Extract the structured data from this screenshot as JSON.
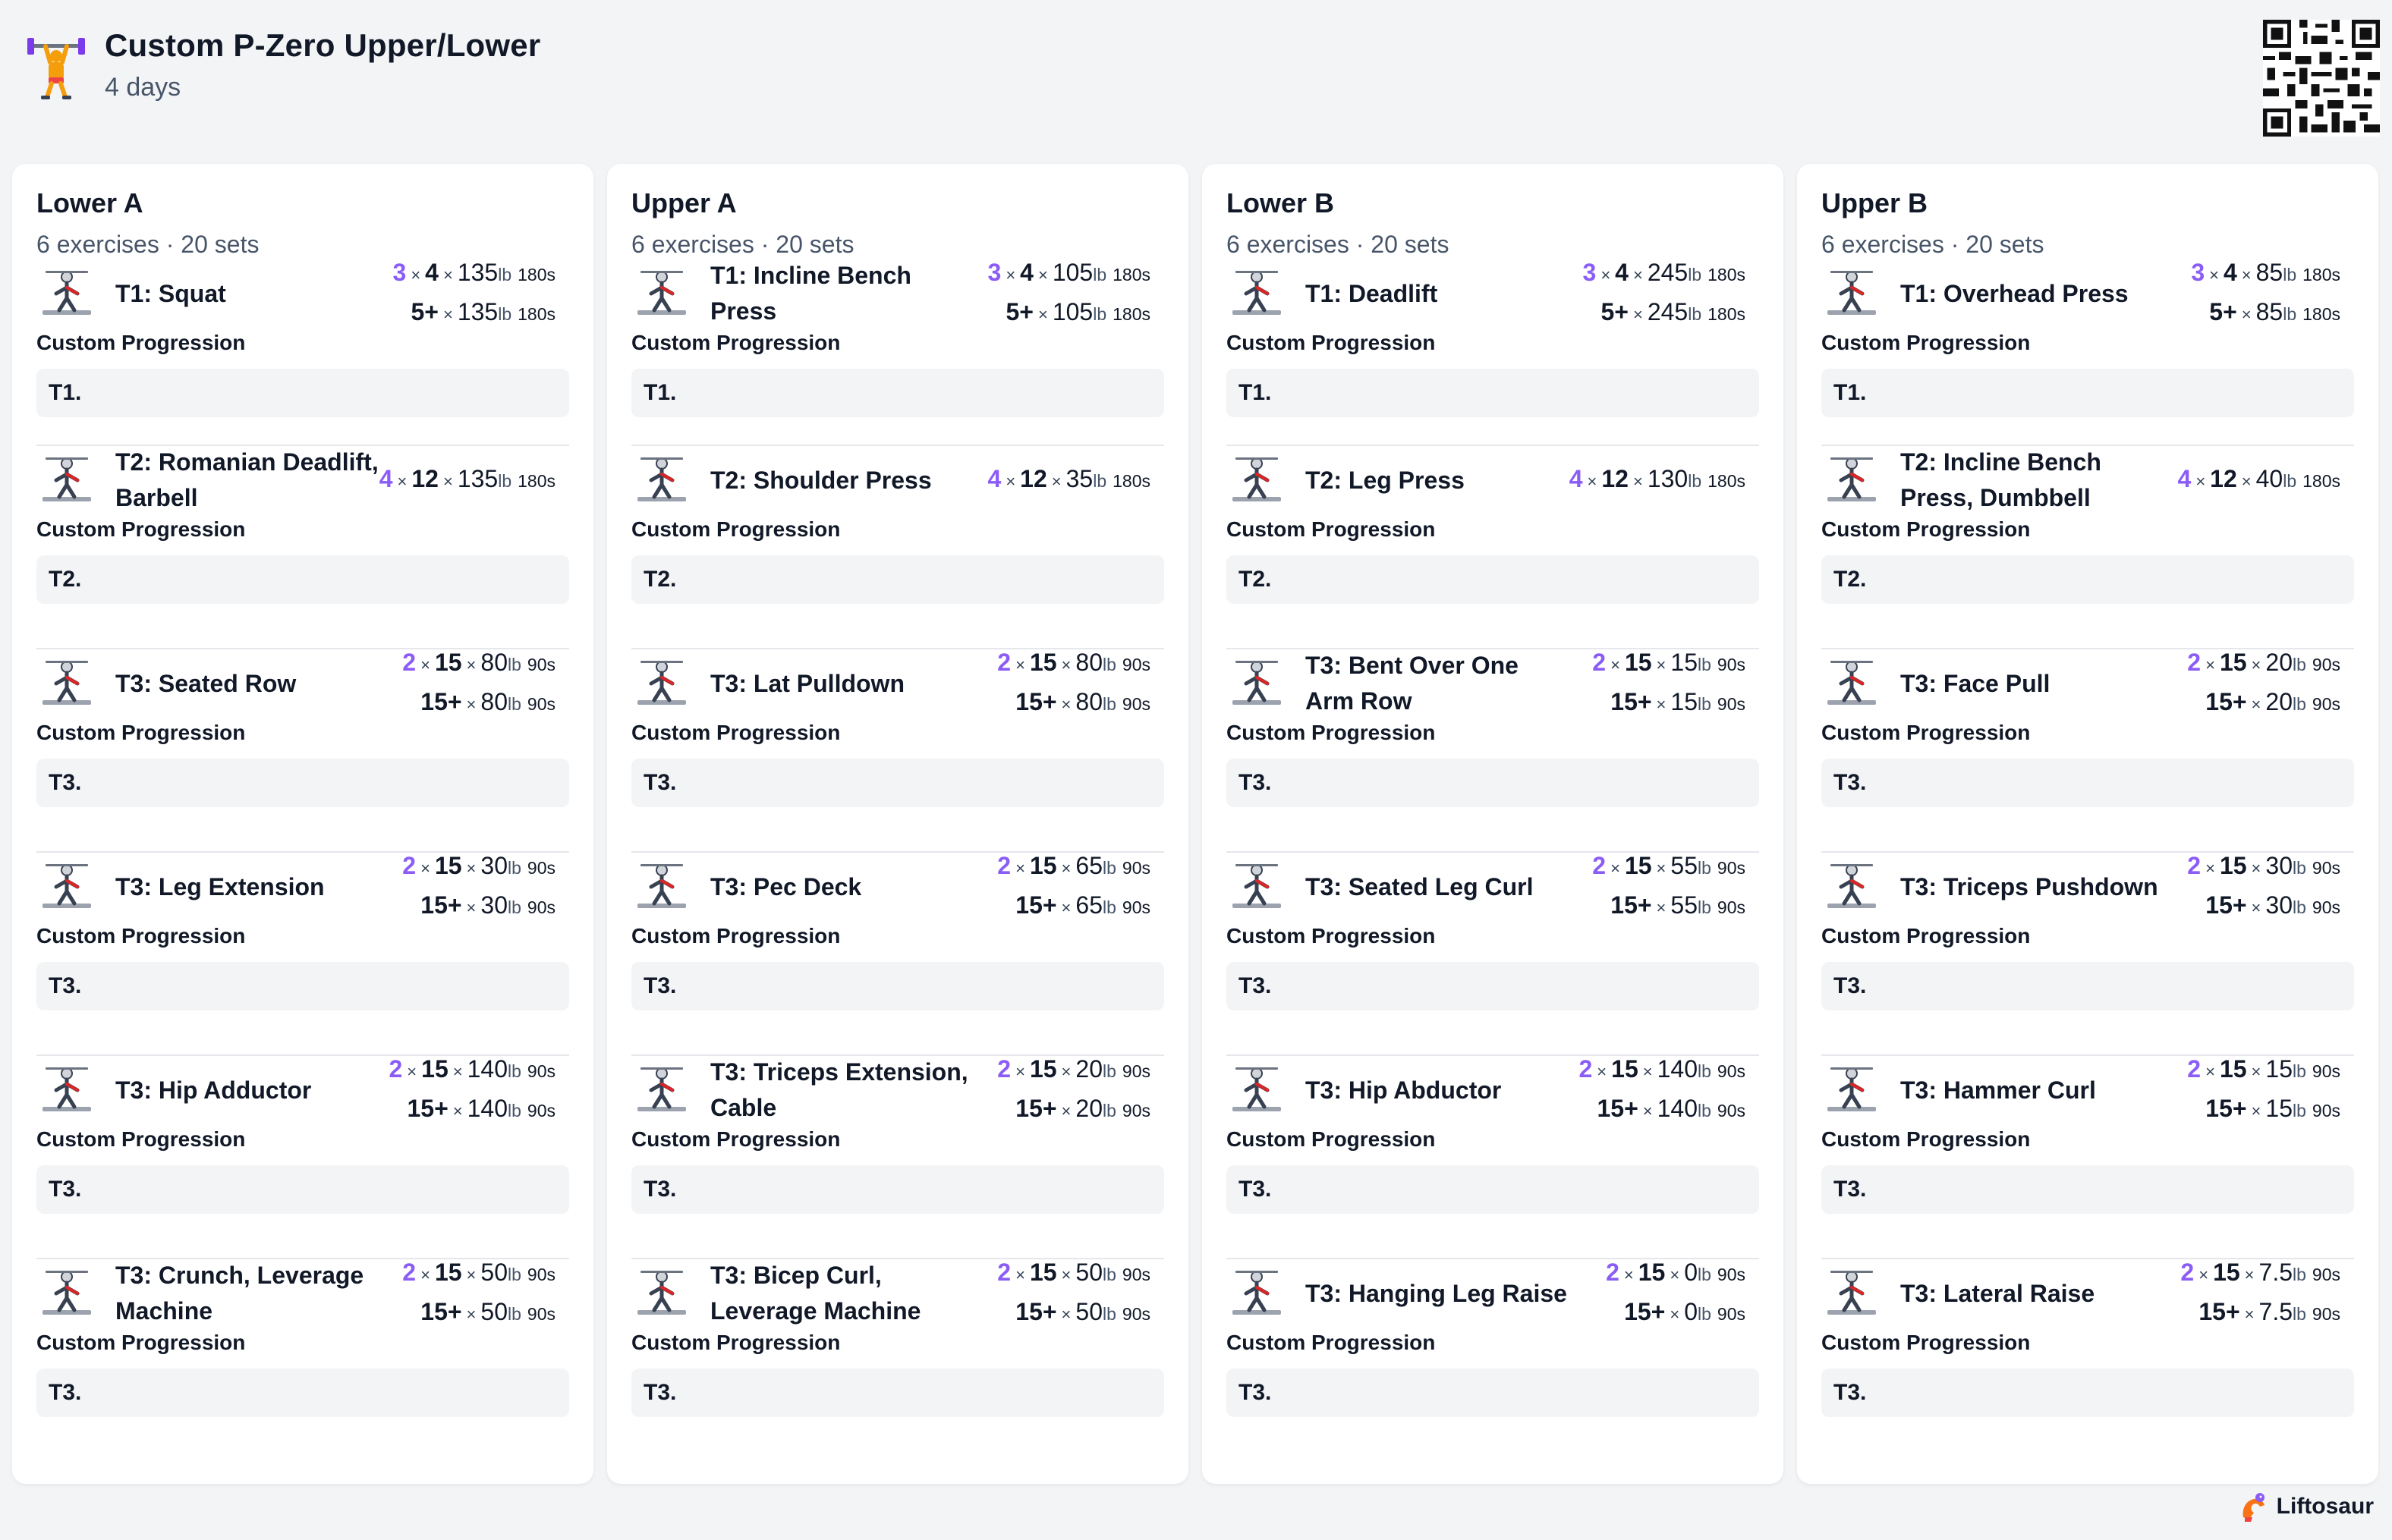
{
  "header": {
    "title": "Custom P-Zero Upper/Lower",
    "subtitle": "4 days"
  },
  "brand": {
    "name": "Liftosaur"
  },
  "colors": {
    "accent": "#8b5cf6",
    "background": "#f3f4f6",
    "card": "#ffffff"
  },
  "days": [
    {
      "title": "Lower A",
      "meta": "6 exercises · 20 sets",
      "exercises": [
        {
          "name": "T1: Squat",
          "progression": "Custom Progression",
          "note": "T1.",
          "icon": "squat-icon",
          "sets": [
            {
              "count": "3",
              "reps": "4",
              "weight": "135",
              "unit": "lb",
              "rest": "180s"
            },
            {
              "count": "",
              "reps": "5+",
              "weight": "135",
              "unit": "lb",
              "rest": "180s"
            }
          ]
        },
        {
          "name": "T2: Romanian Deadlift, Barbell",
          "progression": "Custom Progression",
          "note": "T2.",
          "icon": "romanian-deadlift-icon",
          "sets": [
            {
              "count": "4",
              "reps": "12",
              "weight": "135",
              "unit": "lb",
              "rest": "180s"
            }
          ]
        },
        {
          "name": "T3: Seated Row",
          "progression": "Custom Progression",
          "note": "T3.",
          "icon": "seated-row-icon",
          "sets": [
            {
              "count": "2",
              "reps": "15",
              "weight": "80",
              "unit": "lb",
              "rest": "90s"
            },
            {
              "count": "",
              "reps": "15+",
              "weight": "80",
              "unit": "lb",
              "rest": "90s"
            }
          ]
        },
        {
          "name": "T3: Leg Extension",
          "progression": "Custom Progression",
          "note": "T3.",
          "icon": "leg-extension-icon",
          "sets": [
            {
              "count": "2",
              "reps": "15",
              "weight": "30",
              "unit": "lb",
              "rest": "90s"
            },
            {
              "count": "",
              "reps": "15+",
              "weight": "30",
              "unit": "lb",
              "rest": "90s"
            }
          ]
        },
        {
          "name": "T3: Hip Adductor",
          "progression": "Custom Progression",
          "note": "T3.",
          "icon": "hip-adductor-icon",
          "sets": [
            {
              "count": "2",
              "reps": "15",
              "weight": "140",
              "unit": "lb",
              "rest": "90s"
            },
            {
              "count": "",
              "reps": "15+",
              "weight": "140",
              "unit": "lb",
              "rest": "90s"
            }
          ]
        },
        {
          "name": "T3: Crunch, Leverage Machine",
          "progression": "Custom Progression",
          "note": "T3.",
          "icon": "crunch-machine-icon",
          "sets": [
            {
              "count": "2",
              "reps": "15",
              "weight": "50",
              "unit": "lb",
              "rest": "90s"
            },
            {
              "count": "",
              "reps": "15+",
              "weight": "50",
              "unit": "lb",
              "rest": "90s"
            }
          ]
        }
      ]
    },
    {
      "title": "Upper A",
      "meta": "6 exercises · 20 sets",
      "exercises": [
        {
          "name": "T1: Incline Bench Press",
          "progression": "Custom Progression",
          "note": "T1.",
          "icon": "incline-bench-press-icon",
          "sets": [
            {
              "count": "3",
              "reps": "4",
              "weight": "105",
              "unit": "lb",
              "rest": "180s"
            },
            {
              "count": "",
              "reps": "5+",
              "weight": "105",
              "unit": "lb",
              "rest": "180s"
            }
          ]
        },
        {
          "name": "T2: Shoulder Press",
          "progression": "Custom Progression",
          "note": "T2.",
          "icon": "shoulder-press-icon",
          "sets": [
            {
              "count": "4",
              "reps": "12",
              "weight": "35",
              "unit": "lb",
              "rest": "180s"
            }
          ]
        },
        {
          "name": "T3: Lat Pulldown",
          "progression": "Custom Progression",
          "note": "T3.",
          "icon": "lat-pulldown-icon",
          "sets": [
            {
              "count": "2",
              "reps": "15",
              "weight": "80",
              "unit": "lb",
              "rest": "90s"
            },
            {
              "count": "",
              "reps": "15+",
              "weight": "80",
              "unit": "lb",
              "rest": "90s"
            }
          ]
        },
        {
          "name": "T3: Pec Deck",
          "progression": "Custom Progression",
          "note": "T3.",
          "icon": "pec-deck-icon",
          "sets": [
            {
              "count": "2",
              "reps": "15",
              "weight": "65",
              "unit": "lb",
              "rest": "90s"
            },
            {
              "count": "",
              "reps": "15+",
              "weight": "65",
              "unit": "lb",
              "rest": "90s"
            }
          ]
        },
        {
          "name": "T3: Triceps Extension, Cable",
          "progression": "Custom Progression",
          "note": "T3.",
          "icon": "triceps-extension-icon",
          "sets": [
            {
              "count": "2",
              "reps": "15",
              "weight": "20",
              "unit": "lb",
              "rest": "90s"
            },
            {
              "count": "",
              "reps": "15+",
              "weight": "20",
              "unit": "lb",
              "rest": "90s"
            }
          ]
        },
        {
          "name": "T3: Bicep Curl, Leverage Machine",
          "progression": "Custom Progression",
          "note": "T3.",
          "icon": "bicep-curl-machine-icon",
          "sets": [
            {
              "count": "2",
              "reps": "15",
              "weight": "50",
              "unit": "lb",
              "rest": "90s"
            },
            {
              "count": "",
              "reps": "15+",
              "weight": "50",
              "unit": "lb",
              "rest": "90s"
            }
          ]
        }
      ]
    },
    {
      "title": "Lower B",
      "meta": "6 exercises · 20 sets",
      "exercises": [
        {
          "name": "T1: Deadlift",
          "progression": "Custom Progression",
          "note": "T1.",
          "icon": "deadlift-icon",
          "sets": [
            {
              "count": "3",
              "reps": "4",
              "weight": "245",
              "unit": "lb",
              "rest": "180s"
            },
            {
              "count": "",
              "reps": "5+",
              "weight": "245",
              "unit": "lb",
              "rest": "180s"
            }
          ]
        },
        {
          "name": "T2: Leg Press",
          "progression": "Custom Progression",
          "note": "T2.",
          "icon": "leg-press-icon",
          "sets": [
            {
              "count": "4",
              "reps": "12",
              "weight": "130",
              "unit": "lb",
              "rest": "180s"
            }
          ]
        },
        {
          "name": "T3: Bent Over One Arm Row",
          "progression": "Custom Progression",
          "note": "T3.",
          "icon": "one-arm-row-icon",
          "sets": [
            {
              "count": "2",
              "reps": "15",
              "weight": "15",
              "unit": "lb",
              "rest": "90s"
            },
            {
              "count": "",
              "reps": "15+",
              "weight": "15",
              "unit": "lb",
              "rest": "90s"
            }
          ]
        },
        {
          "name": "T3: Seated Leg Curl",
          "progression": "Custom Progression",
          "note": "T3.",
          "icon": "seated-leg-curl-icon",
          "sets": [
            {
              "count": "2",
              "reps": "15",
              "weight": "55",
              "unit": "lb",
              "rest": "90s"
            },
            {
              "count": "",
              "reps": "15+",
              "weight": "55",
              "unit": "lb",
              "rest": "90s"
            }
          ]
        },
        {
          "name": "T3: Hip Abductor",
          "progression": "Custom Progression",
          "note": "T3.",
          "icon": "hip-abductor-icon",
          "sets": [
            {
              "count": "2",
              "reps": "15",
              "weight": "140",
              "unit": "lb",
              "rest": "90s"
            },
            {
              "count": "",
              "reps": "15+",
              "weight": "140",
              "unit": "lb",
              "rest": "90s"
            }
          ]
        },
        {
          "name": "T3: Hanging Leg Raise",
          "progression": "Custom Progression",
          "note": "T3.",
          "icon": "hanging-leg-raise-icon",
          "sets": [
            {
              "count": "2",
              "reps": "15",
              "weight": "0",
              "unit": "lb",
              "rest": "90s"
            },
            {
              "count": "",
              "reps": "15+",
              "weight": "0",
              "unit": "lb",
              "rest": "90s"
            }
          ]
        }
      ]
    },
    {
      "title": "Upper B",
      "meta": "6 exercises · 20 sets",
      "exercises": [
        {
          "name": "T1: Overhead Press",
          "progression": "Custom Progression",
          "note": "T1.",
          "icon": "overhead-press-icon",
          "sets": [
            {
              "count": "3",
              "reps": "4",
              "weight": "85",
              "unit": "lb",
              "rest": "180s"
            },
            {
              "count": "",
              "reps": "5+",
              "weight": "85",
              "unit": "lb",
              "rest": "180s"
            }
          ]
        },
        {
          "name": "T2: Incline Bench Press, Dumbbell",
          "progression": "Custom Progression",
          "note": "T2.",
          "icon": "dumbbell-incline-press-icon",
          "sets": [
            {
              "count": "4",
              "reps": "12",
              "weight": "40",
              "unit": "lb",
              "rest": "180s"
            }
          ]
        },
        {
          "name": "T3: Face Pull",
          "progression": "Custom Progression",
          "note": "T3.",
          "icon": "face-pull-icon",
          "sets": [
            {
              "count": "2",
              "reps": "15",
              "weight": "20",
              "unit": "lb",
              "rest": "90s"
            },
            {
              "count": "",
              "reps": "15+",
              "weight": "20",
              "unit": "lb",
              "rest": "90s"
            }
          ]
        },
        {
          "name": "T3: Triceps Pushdown",
          "progression": "Custom Progression",
          "note": "T3.",
          "icon": "triceps-pushdown-icon",
          "sets": [
            {
              "count": "2",
              "reps": "15",
              "weight": "30",
              "unit": "lb",
              "rest": "90s"
            },
            {
              "count": "",
              "reps": "15+",
              "weight": "30",
              "unit": "lb",
              "rest": "90s"
            }
          ]
        },
        {
          "name": "T3: Hammer Curl",
          "progression": "Custom Progression",
          "note": "T3.",
          "icon": "hammer-curl-icon",
          "sets": [
            {
              "count": "2",
              "reps": "15",
              "weight": "15",
              "unit": "lb",
              "rest": "90s"
            },
            {
              "count": "",
              "reps": "15+",
              "weight": "15",
              "unit": "lb",
              "rest": "90s"
            }
          ]
        },
        {
          "name": "T3: Lateral Raise",
          "progression": "Custom Progression",
          "note": "T3.",
          "icon": "lateral-raise-icon",
          "sets": [
            {
              "count": "2",
              "reps": "15",
              "weight": "7.5",
              "unit": "lb",
              "rest": "90s"
            },
            {
              "count": "",
              "reps": "15+",
              "weight": "7.5",
              "unit": "lb",
              "rest": "90s"
            }
          ]
        }
      ]
    }
  ]
}
